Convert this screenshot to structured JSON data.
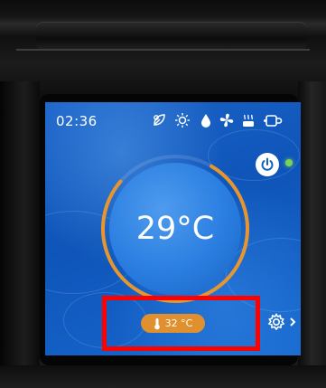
{
  "status_bar": {
    "time": "02:36",
    "icons": [
      "leaf-power-icon",
      "sun-icon",
      "water-drop-icon",
      "fan-icon",
      "heater-icon",
      "cup-icon"
    ]
  },
  "main": {
    "current_temperature": "29°C",
    "water_temperature": "32 °C",
    "power_state": "on",
    "dial_progress_fraction": 0.78
  },
  "controls": {
    "power_icon": "power-icon",
    "settings_icon": "gear-icon",
    "settings_arrow_icon": "chevron-right-icon"
  },
  "colors": {
    "screen_blue": "#1560c4",
    "dial_arc": "#e7962f",
    "pill_orange": "#e0902f",
    "power_led_green": "#7ad15a",
    "highlight_red": "#ff0000"
  }
}
